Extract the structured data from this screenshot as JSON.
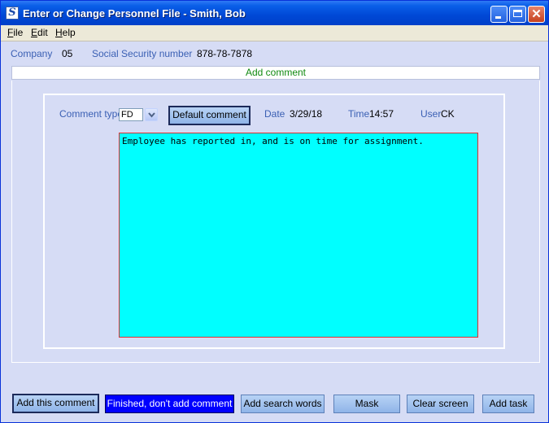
{
  "window": {
    "title": "Enter or Change Personnel File - Smith, Bob",
    "app_icon_letter": "S"
  },
  "menu": {
    "file": {
      "mnemonic": "F",
      "rest": "ile"
    },
    "edit": {
      "mnemonic": "E",
      "rest": "dit"
    },
    "help": {
      "mnemonic": "H",
      "rest": "elp"
    }
  },
  "header": {
    "company_label": "Company",
    "company_value": "05",
    "ssn_label": "Social Security number",
    "ssn_value": "878-78-7878"
  },
  "banner": "Add comment",
  "form": {
    "comment_type_label": "Comment type",
    "comment_type_value": "FD",
    "default_comment_button": "Default comment",
    "date_label": "Date",
    "date_value": "3/29/18",
    "time_label": "Time",
    "time_value": "14:57",
    "user_label": "User",
    "user_value": "CK",
    "comment_text": "Employee has reported in, and is on time for assignment."
  },
  "buttons": {
    "add_comment": "Add this comment",
    "finished": "Finished, don't add comment",
    "add_search_words": "Add search words",
    "mask": "Mask",
    "clear_screen": "Clear screen",
    "add_task": "Add task"
  },
  "colors": {
    "comment_bg": "#00ffff",
    "primary_button": "#0000ff",
    "label_blue": "#3b60b4",
    "banner_green": "#118a11"
  }
}
